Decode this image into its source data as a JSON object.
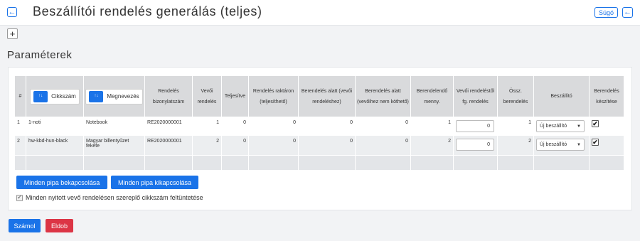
{
  "header": {
    "back_icon": "arrow-left-icon",
    "title": "Beszállítói rendelés generálás (teljes)",
    "help_label": "Súgó"
  },
  "toolbar": {
    "add_icon": "plus-icon",
    "add_symbol": "+"
  },
  "section": {
    "title": "Paraméterek"
  },
  "table": {
    "chip_icon_text": "↑↓",
    "columns": [
      {
        "key": "index",
        "label": "#"
      },
      {
        "key": "sku",
        "label": "Cikkszám"
      },
      {
        "key": "name",
        "label": "Megnevezés"
      },
      {
        "key": "order_number",
        "label": "Rendelés bizonylatszám"
      },
      {
        "key": "customer_order",
        "label": "Vevői rendelés"
      },
      {
        "key": "fulfilled",
        "label": "Teljesítve"
      },
      {
        "key": "order_in_stock",
        "label": "Rendelés raktáron (teljesíthető)"
      },
      {
        "key": "ordering_for_customer",
        "label": "Berendelés alatt (vevői rendeléshez)"
      },
      {
        "key": "ordering_unlinked",
        "label": "Berendelés alatt (vevőihez nem köthető)"
      },
      {
        "key": "qty_to_order",
        "label": "Berendelendő menny."
      },
      {
        "key": "customer_order_dep",
        "label": "Vevői rendeléstől fg. rendelés"
      },
      {
        "key": "total_order",
        "label": "Össz. berendelés"
      },
      {
        "key": "supplier",
        "label": "Beszállító"
      },
      {
        "key": "create_order",
        "label": "Berendelés készítése"
      }
    ],
    "rows": [
      {
        "index": "1",
        "sku": "1-noti",
        "name": "Notebook",
        "order_number": "RE2020000001",
        "customer_order": "1",
        "fulfilled": "0",
        "order_in_stock": "0",
        "ordering_for_customer": "0",
        "ordering_unlinked": "0",
        "qty_to_order": "1",
        "customer_order_dep": "0",
        "total_order": "1",
        "supplier": "Új beszállító",
        "create_order": true
      },
      {
        "index": "2",
        "sku": "hw-kbd-hun-black",
        "name": "Magyar billentyűzet fekete",
        "order_number": "RE2020000001",
        "customer_order": "2",
        "fulfilled": "0",
        "order_in_stock": "0",
        "ordering_for_customer": "0",
        "ordering_unlinked": "0",
        "qty_to_order": "2",
        "customer_order_dep": "0",
        "total_order": "2",
        "supplier": "Új beszállító",
        "create_order": true
      }
    ]
  },
  "buttons": {
    "check_all": "Minden pipa bekapcsolása",
    "uncheck_all": "Minden pipa kikapcsolása",
    "calculate": "Számol",
    "discard": "Eldob"
  },
  "option": {
    "label": "Minden nyitott vevő rendelésen szereplő cikkszám feltüntetése",
    "checked": true
  },
  "colors": {
    "primary": "#1a73e8",
    "danger": "#dc3545",
    "header_bg": "#d9dadc"
  }
}
